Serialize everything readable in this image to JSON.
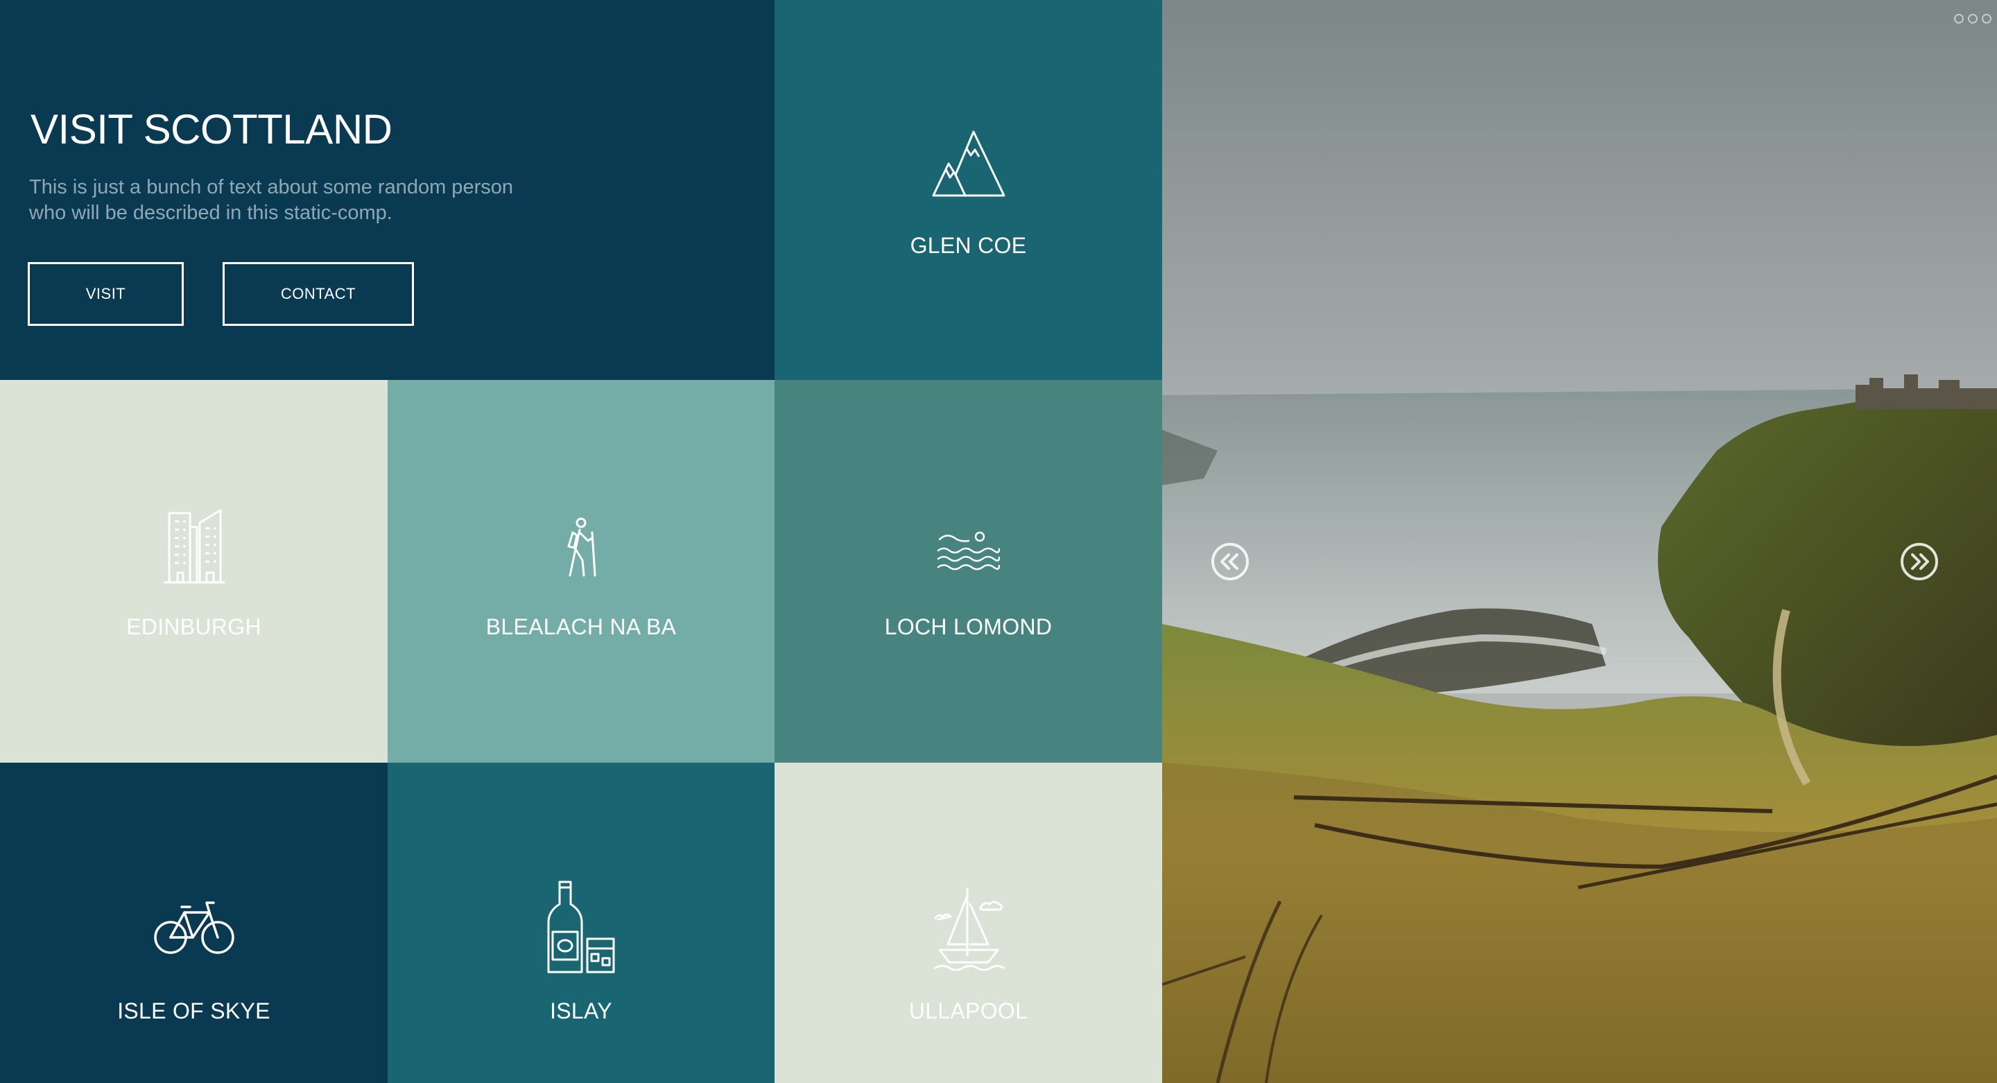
{
  "hero": {
    "title": "VISIT SCOTTLAND",
    "description": "This is just a bunch of text about some random person who will be described in this static-comp.",
    "buttons": {
      "visit": "VISIT",
      "contact": "CONTACT"
    }
  },
  "tiles": {
    "glen_coe": {
      "label": "GLEN COE",
      "icon": "mountain-icon"
    },
    "edinburgh": {
      "label": "EDINBURGH",
      "icon": "city-buildings-icon"
    },
    "bealach": {
      "label": "BLEALACH NA BA",
      "icon": "hiker-icon"
    },
    "loch_lomond": {
      "label": "LOCH LOMOND",
      "icon": "swimmer-waves-icon"
    },
    "isle_of_skye": {
      "label": "ISLE OF SKYE",
      "icon": "bicycle-icon"
    },
    "islay": {
      "label": "ISLAY",
      "icon": "whisky-bottle-icon"
    },
    "ullapool": {
      "label": "ULLAPOOL",
      "icon": "sailboat-icon"
    }
  },
  "carousel": {
    "prev_icon": "chevron-double-left-icon",
    "next_icon": "chevron-double-right-icon",
    "dot_count": 3,
    "image": "coastal-cliff-castle-photo"
  },
  "colors": {
    "navy": "#0a3a52",
    "teal": "#196572",
    "grey_teal": "#47837f",
    "sea": "#74aca7",
    "mist": "#dae3d5"
  }
}
